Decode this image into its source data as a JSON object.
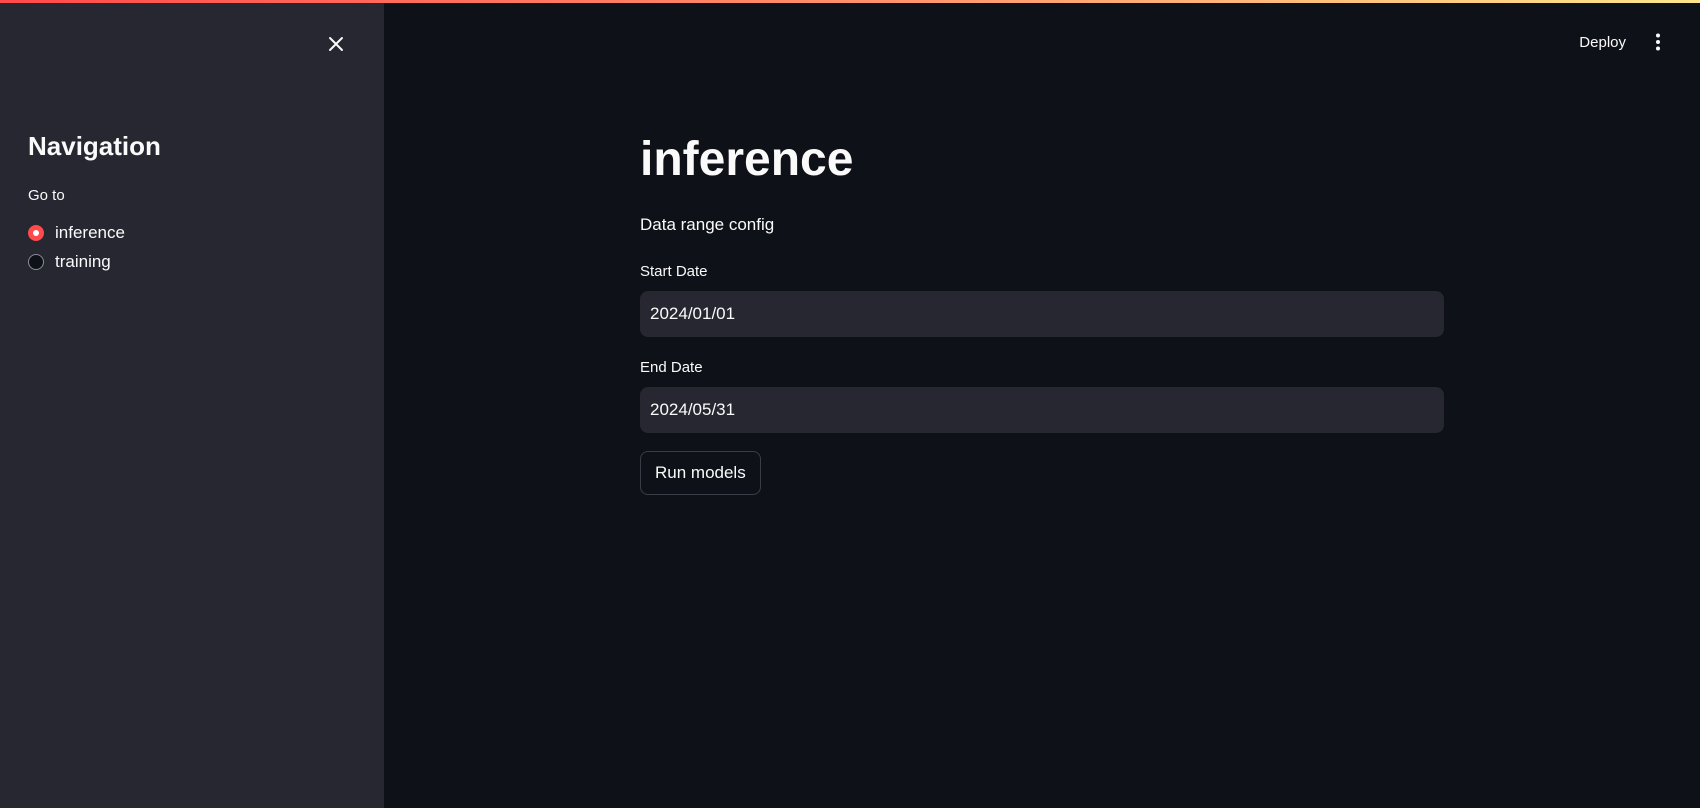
{
  "app": {
    "accent_color": "#ff4b4b"
  },
  "header": {
    "deploy_label": "Deploy",
    "menu_icon": "kebab-menu-icon"
  },
  "sidebar": {
    "close_icon": "close-icon",
    "title": "Navigation",
    "radio_label": "Go to",
    "options": [
      {
        "label": "inference",
        "selected": true
      },
      {
        "label": "training",
        "selected": false
      }
    ]
  },
  "main": {
    "title": "inference",
    "subheading": "Data range config",
    "start_date": {
      "label": "Start Date",
      "value": "2024/01/01"
    },
    "end_date": {
      "label": "End Date",
      "value": "2024/05/31"
    },
    "run_button_label": "Run models"
  }
}
